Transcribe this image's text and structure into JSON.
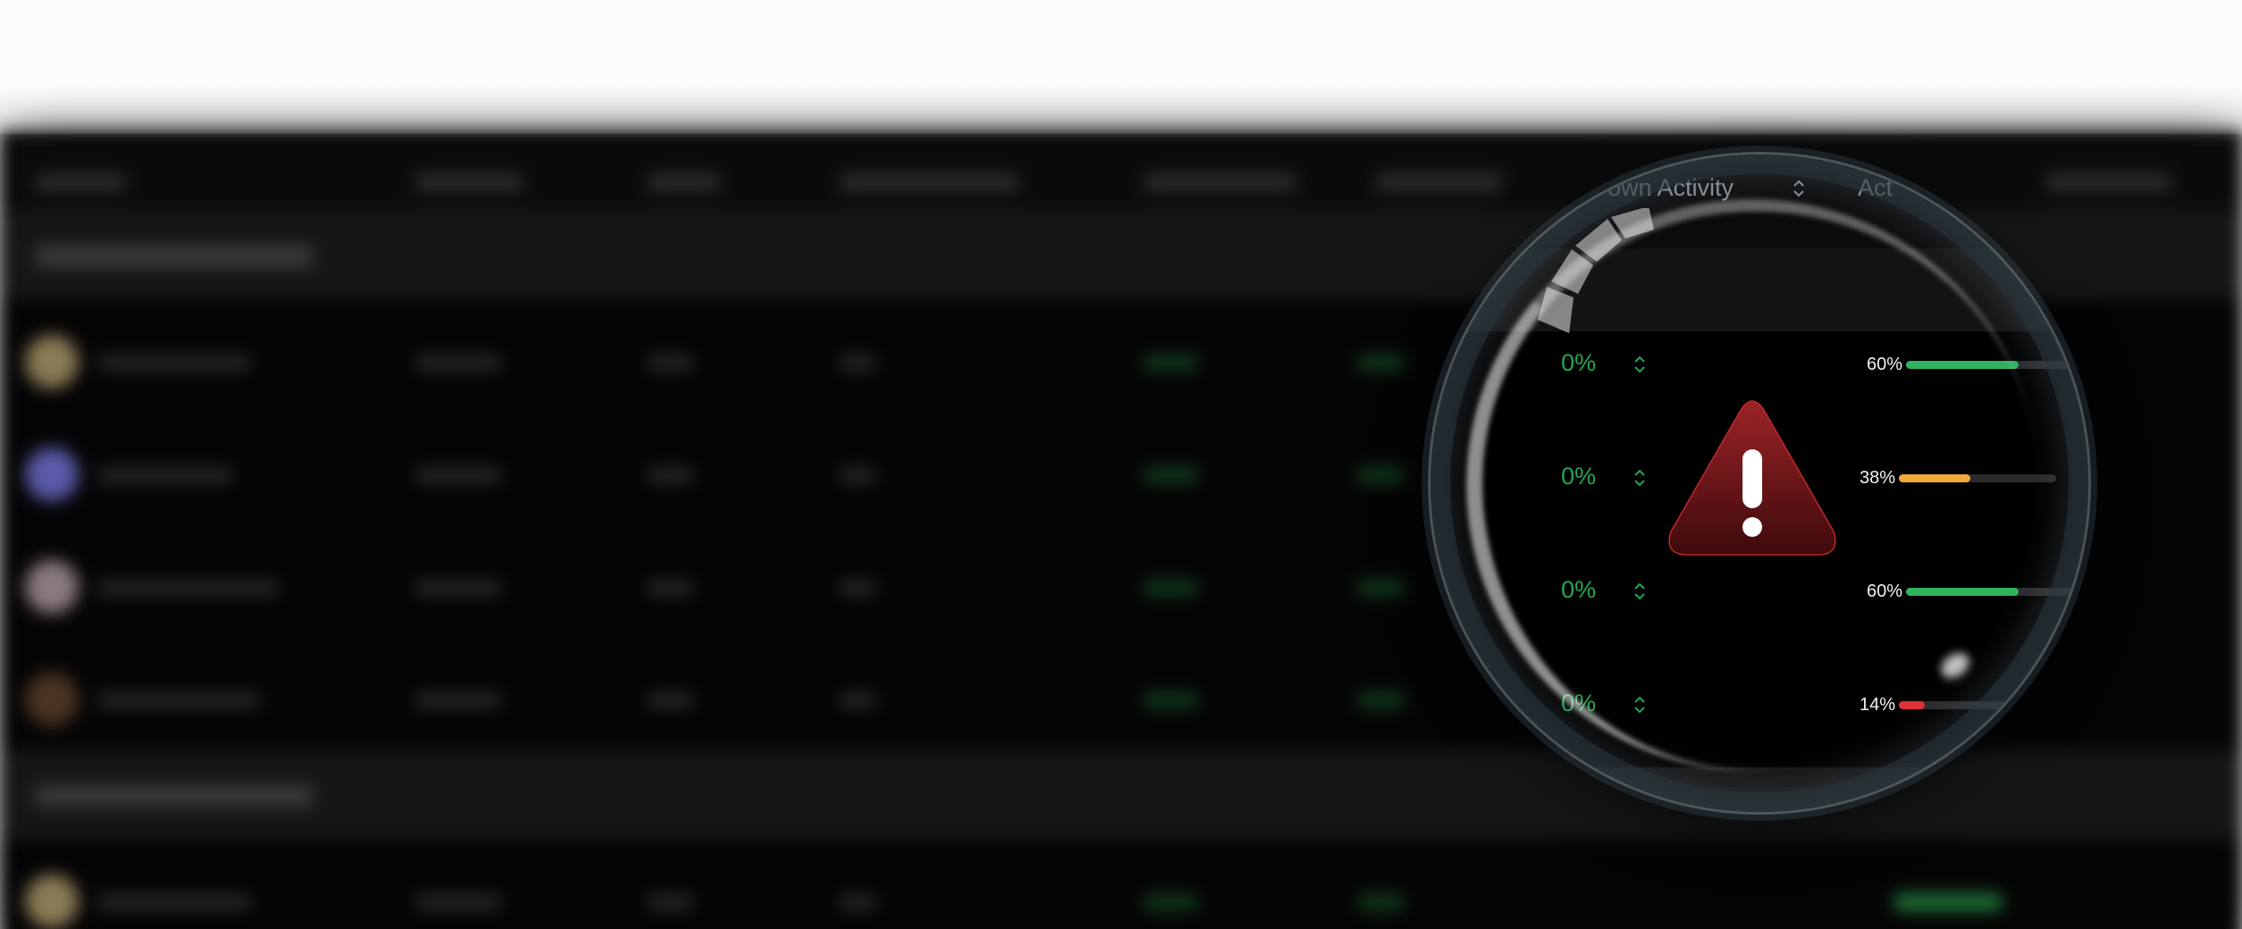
{
  "columns": {
    "activity_header": "own Activity",
    "next_header": "Act"
  },
  "rows": [
    {
      "change": "0%",
      "progress_label": "60%",
      "progress": 0.6,
      "bar_color": "#2fb35f"
    },
    {
      "change": "0%",
      "progress_label": "38%",
      "progress": 0.38,
      "bar_color": "#f2a93b"
    },
    {
      "change": "0%",
      "progress_label": "60%",
      "progress": 0.6,
      "bar_color": "#2fb35f"
    },
    {
      "change": "0%",
      "progress_label": "14%",
      "progress": 0.14,
      "bar_color": "#e0323a"
    }
  ],
  "icons": {
    "alert": "warning-triangle-icon",
    "sort": "sort-chevrons-icon"
  },
  "colors": {
    "positive": "#23a653",
    "alert": "#8e1f22",
    "background": "#050405"
  }
}
